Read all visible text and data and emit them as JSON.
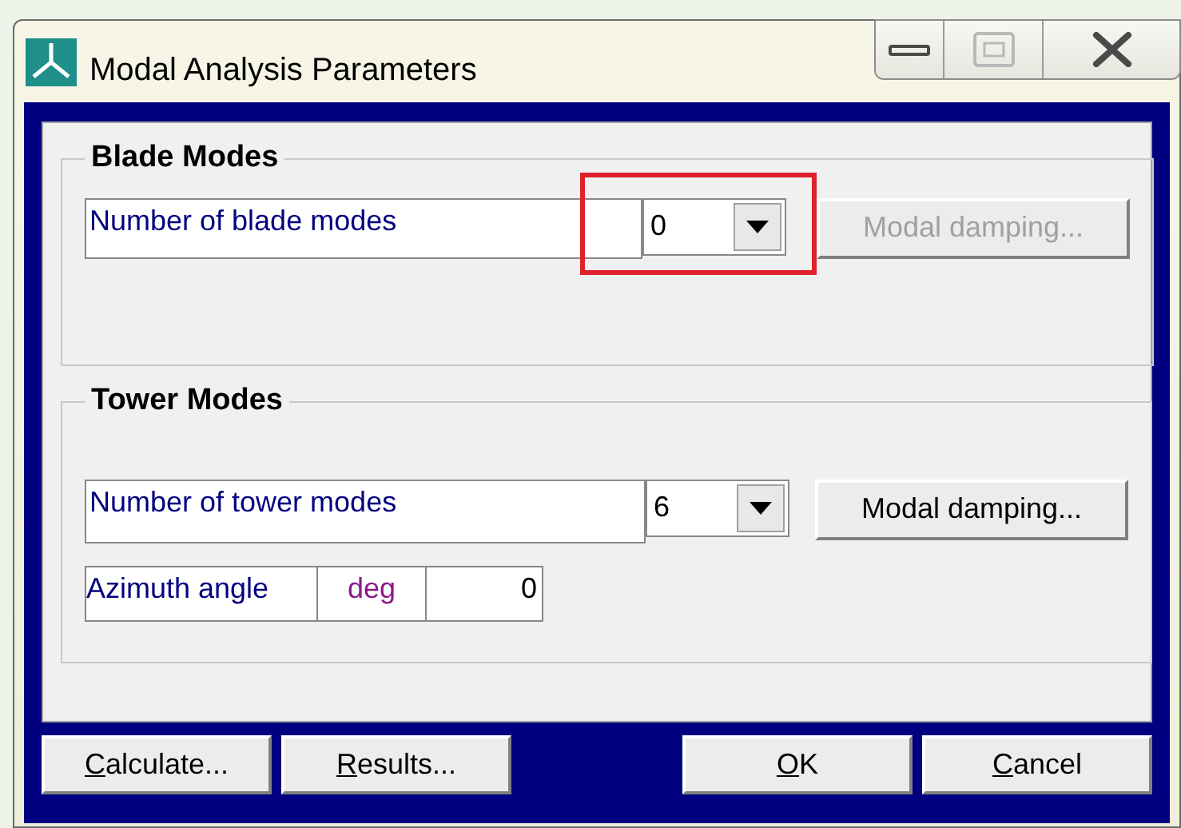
{
  "window": {
    "title": "Modal Analysis Parameters"
  },
  "title_bar_buttons": [
    {
      "kind": "minimize",
      "disabled": false
    },
    {
      "kind": "maximize",
      "disabled": true
    },
    {
      "kind": "close",
      "disabled": false
    }
  ],
  "blade_modes": {
    "title": "Blade Modes",
    "count_label": "Number of blade modes",
    "count_value": "0",
    "highlighted": true,
    "damping_button": {
      "label": "Modal damping...",
      "disabled": true
    }
  },
  "tower_modes": {
    "title": "Tower Modes",
    "count_label": "Number of tower modes",
    "count_value": "6",
    "damping_button": {
      "label": "Modal damping...",
      "disabled": false
    },
    "azimuth": {
      "label": "Azimuth angle",
      "unit": "deg",
      "value": "0"
    }
  },
  "left_buttons": [
    {
      "label": "Calculate...",
      "mnemonic": true
    },
    {
      "label": "Results...",
      "mnemonic": true
    }
  ],
  "right_buttons": [
    {
      "label": "OK",
      "mnemonic": true
    },
    {
      "label": "Cancel",
      "mnemonic": true
    }
  ]
}
